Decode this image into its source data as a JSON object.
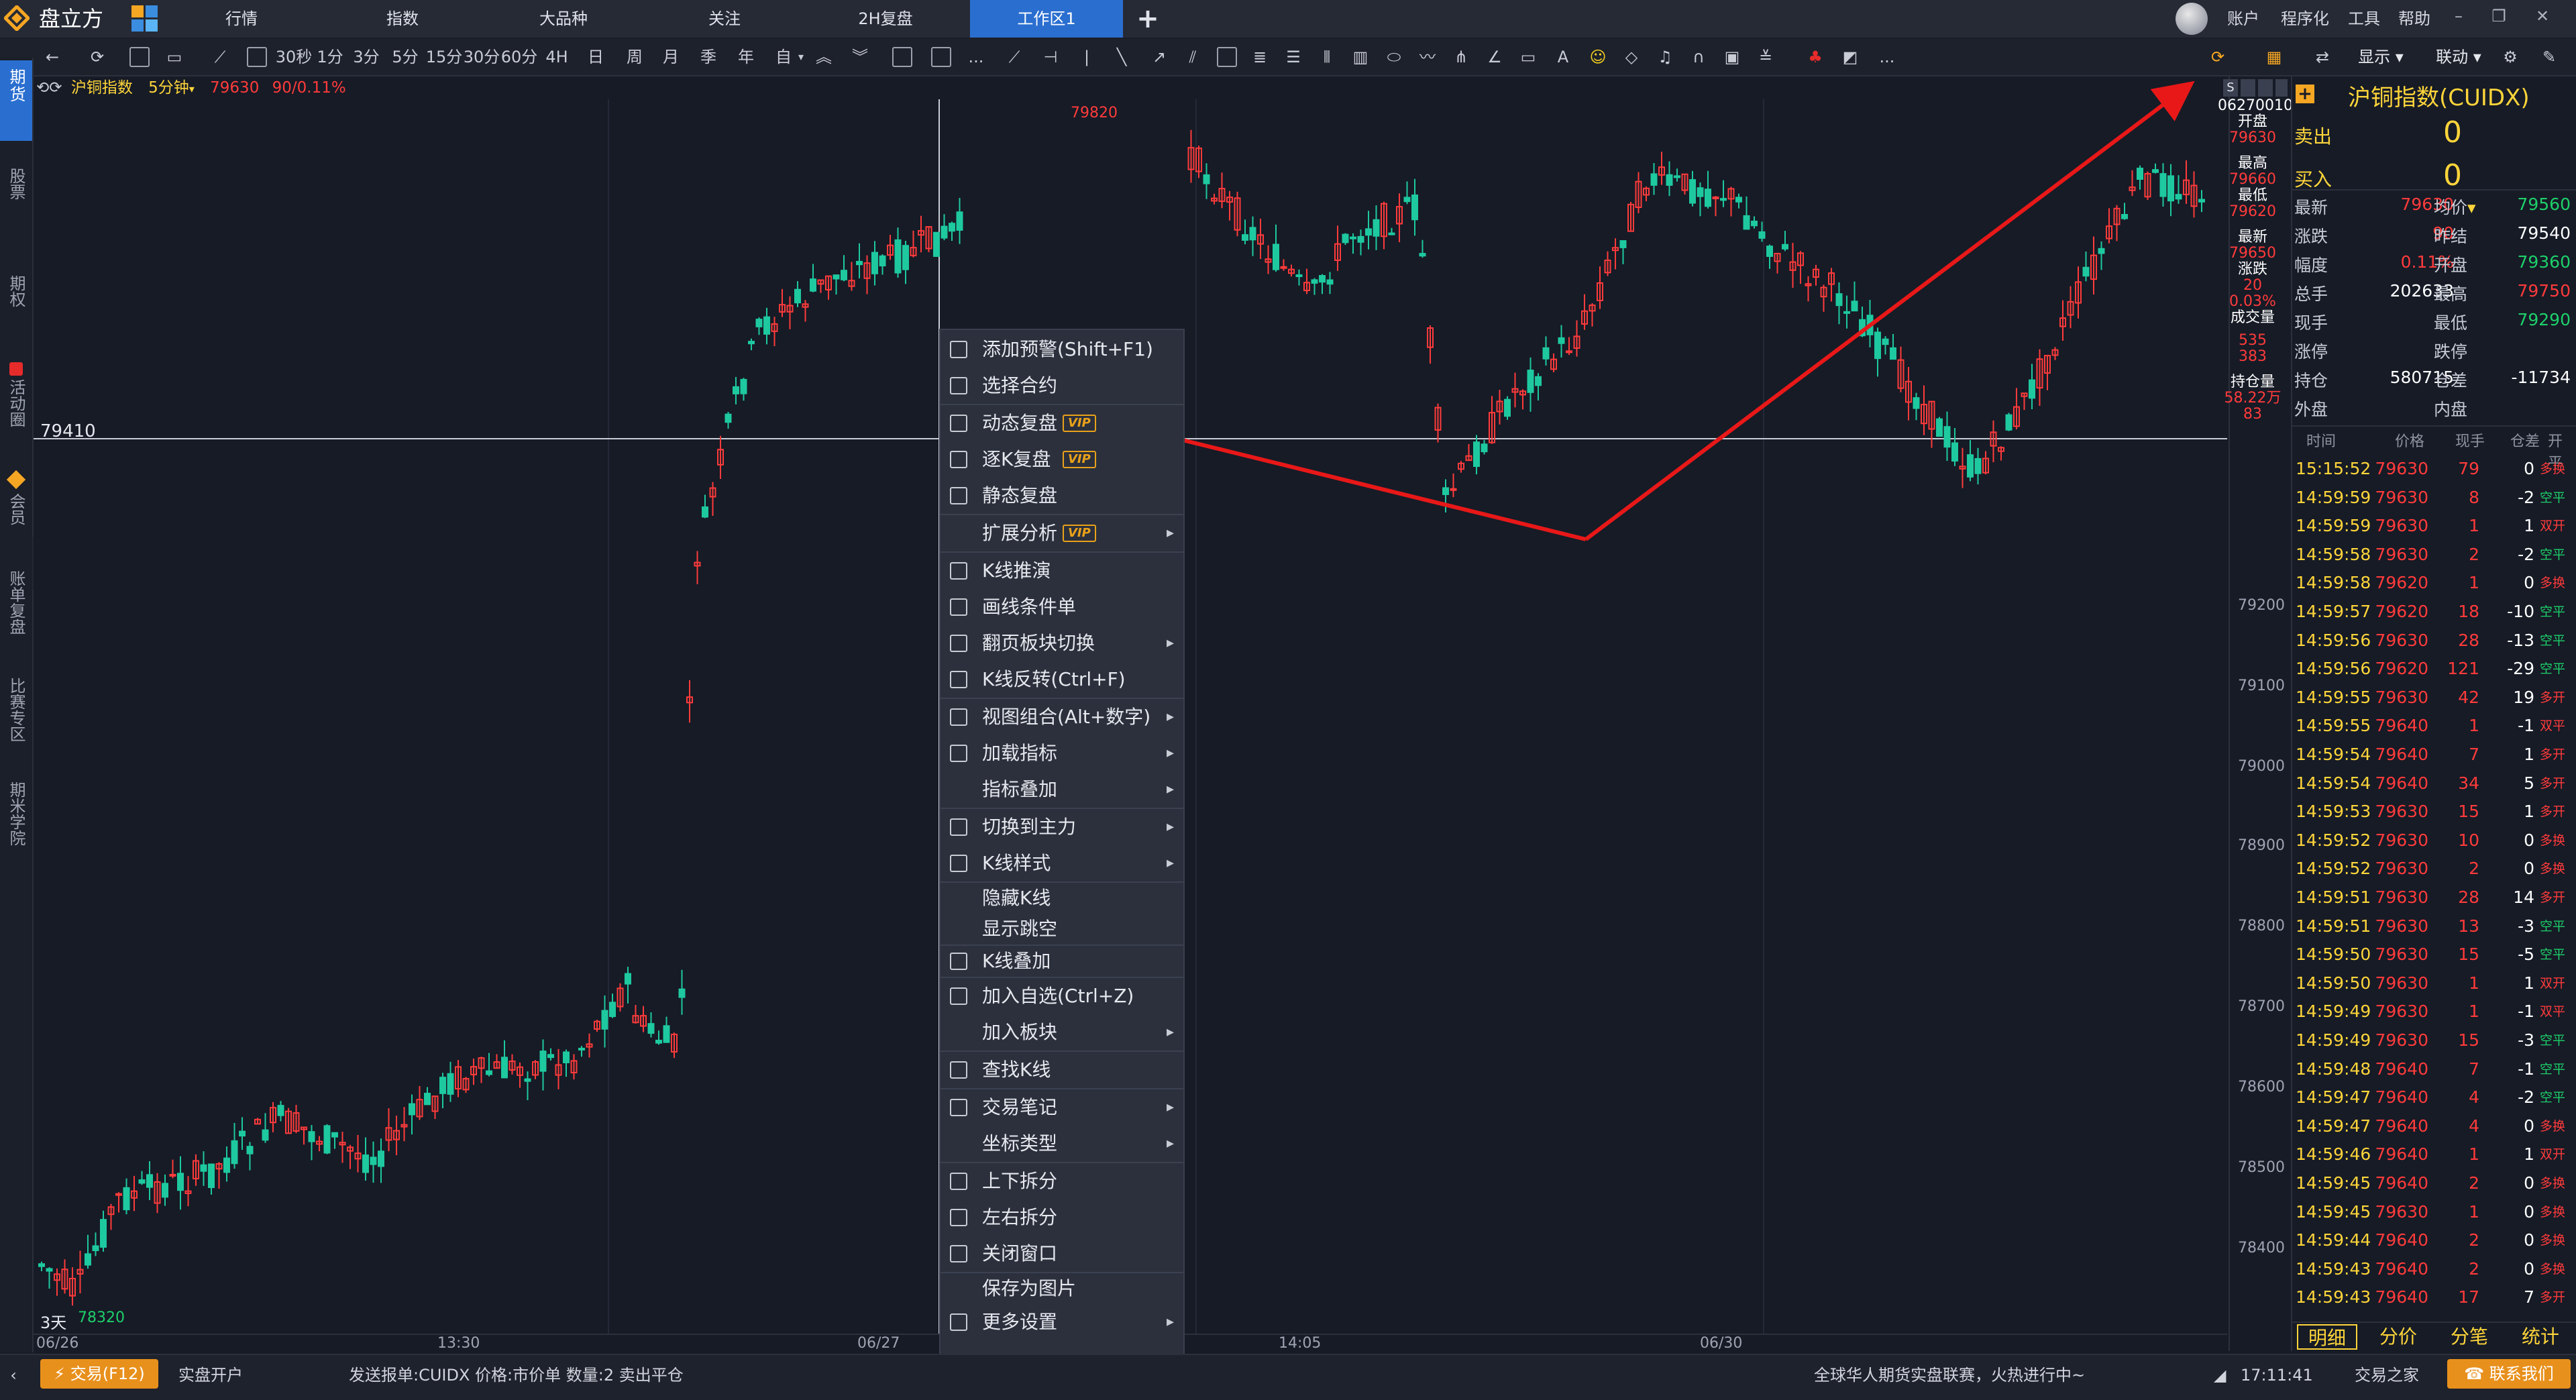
{
  "app": {
    "title": "盘立方"
  },
  "nav": {
    "tabs": [
      {
        "label": "行情"
      },
      {
        "label": "指数"
      },
      {
        "label": "大品种"
      },
      {
        "label": "关注"
      },
      {
        "label": "2H复盘"
      },
      {
        "label": "工作区1"
      }
    ],
    "add": "+",
    "right_menu": [
      "账户",
      "程序化",
      "工具",
      "帮助"
    ]
  },
  "toolbar": {
    "periods": [
      "30秒",
      "1分",
      "3分",
      "5分",
      "15分",
      "30分",
      "60分",
      "4H",
      "日",
      "周",
      "月",
      "季",
      "年",
      "自"
    ],
    "more": "...",
    "right": {
      "display": "显示",
      "link": "联动"
    }
  },
  "sidebar": [
    "期货",
    "股票",
    "期权",
    "活动圈",
    "会员",
    "账单复盘",
    "比赛专区",
    "期米学院"
  ],
  "chart": {
    "symbol": "沪铜指数",
    "period": "5分钟",
    "last": "79630",
    "change": "90/0.11%",
    "crosshair_price": "79410",
    "high_marker": "79820",
    "low_marker": "78320",
    "range_label": "3天",
    "dates": [
      "06/26",
      "13:30",
      "06/27",
      "14:05",
      "06/30"
    ],
    "price_axis": [
      "79200",
      "79100",
      "79000",
      "78900",
      "78800",
      "78700",
      "78600",
      "78500",
      "78400"
    ],
    "info_box": {
      "date": "06270010",
      "open_lbl": "开盘",
      "open": "79630",
      "high_lbl": "最高",
      "high": "79660",
      "low_lbl": "最低",
      "low": "79620",
      "last_lbl": "最新",
      "last": "79650",
      "chg_lbl": "涨跌",
      "chg": "20",
      "chg_pct": "0.03%",
      "vol_lbl": "成交量",
      "vol": "535",
      "vol2": "383",
      "oi_lbl": "持仓量",
      "oi": "58.22万",
      "oi2": "83"
    }
  },
  "context_menu": {
    "items": [
      {
        "label": "添加预警(Shift+F1)",
        "vip": false,
        "sub": false
      },
      {
        "label": "选择合约",
        "vip": false,
        "sub": false
      },
      {
        "label": "动态复盘",
        "vip": true,
        "sub": false
      },
      {
        "label": "逐K复盘",
        "vip": true,
        "sub": false
      },
      {
        "label": "静态复盘",
        "vip": false,
        "sub": false
      },
      {
        "label": "扩展分析",
        "vip": true,
        "sub": true
      },
      {
        "label": "K线推演",
        "vip": false,
        "sub": false
      },
      {
        "label": "画线条件单",
        "vip": false,
        "sub": false
      },
      {
        "label": "翻页板块切换",
        "vip": false,
        "sub": true
      },
      {
        "label": "K线反转(Ctrl+F)",
        "vip": false,
        "sub": false
      },
      {
        "label": "视图组合(Alt+数字)",
        "vip": false,
        "sub": true
      },
      {
        "label": "加载指标",
        "vip": false,
        "sub": true
      },
      {
        "label": "指标叠加",
        "vip": false,
        "sub": true
      },
      {
        "label": "切换到主力",
        "vip": false,
        "sub": true
      },
      {
        "label": "K线样式",
        "vip": false,
        "sub": true
      },
      {
        "label": "隐藏K线",
        "vip": false,
        "sub": false
      },
      {
        "label": "显示跳空",
        "vip": false,
        "sub": false
      },
      {
        "label": "K线叠加",
        "vip": false,
        "sub": false
      },
      {
        "label": "加入自选(Ctrl+Z)",
        "vip": false,
        "sub": false
      },
      {
        "label": "加入板块",
        "vip": false,
        "sub": true
      },
      {
        "label": "查找K线",
        "vip": false,
        "sub": false
      },
      {
        "label": "交易笔记",
        "vip": false,
        "sub": true
      },
      {
        "label": "坐标类型",
        "vip": false,
        "sub": true
      },
      {
        "label": "上下拆分",
        "vip": false,
        "sub": false
      },
      {
        "label": "左右拆分",
        "vip": false,
        "sub": false
      },
      {
        "label": "关闭窗口",
        "vip": false,
        "sub": false
      },
      {
        "label": "保存为图片",
        "vip": false,
        "sub": false
      },
      {
        "label": "更多设置",
        "vip": false,
        "sub": true
      }
    ],
    "vip_tag": "VIP"
  },
  "quote": {
    "title": "沪铜指数(CUIDX)",
    "sell_lbl": "卖出",
    "sell": "0",
    "buy_lbl": "买入",
    "buy": "0",
    "rows": [
      {
        "l1": "最新",
        "v1": "79630",
        "l2": "均价",
        "v2": "79560"
      },
      {
        "l1": "涨跌",
        "v1": "90",
        "l2": "昨结",
        "v2": "79540"
      },
      {
        "l1": "幅度",
        "v1": "0.11%",
        "l2": "开盘",
        "v2": "79360"
      },
      {
        "l1": "总手",
        "v1": "202633",
        "l2": "最高",
        "v2": "79750"
      },
      {
        "l1": "现手",
        "v1": "",
        "l2": "最低",
        "v2": "79290"
      },
      {
        "l1": "涨停",
        "v1": "",
        "l2": "跌停",
        "v2": ""
      },
      {
        "l1": "持仓",
        "v1": "580715",
        "l2": "仓差",
        "v2": "-11734"
      },
      {
        "l1": "外盘",
        "v1": "",
        "l2": "内盘",
        "v2": ""
      }
    ],
    "tick_headers": [
      "时间",
      "价格",
      "现手",
      "仓差",
      "开平"
    ],
    "ticks": [
      {
        "t": "15:15:52",
        "p": "79630",
        "v": "79",
        "d": "0",
        "k": "多换"
      },
      {
        "t": "14:59:59",
        "p": "79630",
        "v": "8",
        "d": "-2",
        "k": "空平"
      },
      {
        "t": "14:59:59",
        "p": "79630",
        "v": "1",
        "d": "1",
        "k": "双开"
      },
      {
        "t": "14:59:58",
        "p": "79630",
        "v": "2",
        "d": "-2",
        "k": "空平"
      },
      {
        "t": "14:59:58",
        "p": "79620",
        "v": "1",
        "d": "0",
        "k": "多换"
      },
      {
        "t": "14:59:57",
        "p": "79620",
        "v": "18",
        "d": "-10",
        "k": "空平"
      },
      {
        "t": "14:59:56",
        "p": "79630",
        "v": "28",
        "d": "-13",
        "k": "空平"
      },
      {
        "t": "14:59:56",
        "p": "79620",
        "v": "121",
        "d": "-29",
        "k": "空平"
      },
      {
        "t": "14:59:55",
        "p": "79630",
        "v": "42",
        "d": "19",
        "k": "多开"
      },
      {
        "t": "14:59:55",
        "p": "79640",
        "v": "1",
        "d": "-1",
        "k": "双平"
      },
      {
        "t": "14:59:54",
        "p": "79640",
        "v": "7",
        "d": "1",
        "k": "多开"
      },
      {
        "t": "14:59:54",
        "p": "79640",
        "v": "34",
        "d": "5",
        "k": "多开"
      },
      {
        "t": "14:59:53",
        "p": "79630",
        "v": "15",
        "d": "1",
        "k": "多开"
      },
      {
        "t": "14:59:52",
        "p": "79630",
        "v": "10",
        "d": "0",
        "k": "多换"
      },
      {
        "t": "14:59:52",
        "p": "79630",
        "v": "2",
        "d": "0",
        "k": "多换"
      },
      {
        "t": "14:59:51",
        "p": "79630",
        "v": "28",
        "d": "14",
        "k": "多开"
      },
      {
        "t": "14:59:51",
        "p": "79630",
        "v": "13",
        "d": "-3",
        "k": "空平"
      },
      {
        "t": "14:59:50",
        "p": "79630",
        "v": "15",
        "d": "-5",
        "k": "空平"
      },
      {
        "t": "14:59:50",
        "p": "79630",
        "v": "1",
        "d": "1",
        "k": "双开"
      },
      {
        "t": "14:59:49",
        "p": "79630",
        "v": "1",
        "d": "-1",
        "k": "双平"
      },
      {
        "t": "14:59:49",
        "p": "79630",
        "v": "15",
        "d": "-3",
        "k": "空平"
      },
      {
        "t": "14:59:48",
        "p": "79640",
        "v": "7",
        "d": "-1",
        "k": "空平"
      },
      {
        "t": "14:59:47",
        "p": "79640",
        "v": "4",
        "d": "-2",
        "k": "空平"
      },
      {
        "t": "14:59:47",
        "p": "79640",
        "v": "4",
        "d": "0",
        "k": "多换"
      },
      {
        "t": "14:59:46",
        "p": "79640",
        "v": "1",
        "d": "1",
        "k": "双开"
      },
      {
        "t": "14:59:45",
        "p": "79640",
        "v": "2",
        "d": "0",
        "k": "多换"
      },
      {
        "t": "14:59:45",
        "p": "79630",
        "v": "1",
        "d": "0",
        "k": "多换"
      },
      {
        "t": "14:59:44",
        "p": "79640",
        "v": "2",
        "d": "0",
        "k": "多换"
      },
      {
        "t": "14:59:43",
        "p": "79640",
        "v": "2",
        "d": "0",
        "k": "多换"
      },
      {
        "t": "14:59:43",
        "p": "79640",
        "v": "17",
        "d": "7",
        "k": "多开"
      }
    ],
    "bottom_tabs": [
      "明细",
      "分价",
      "分笔",
      "统计"
    ]
  },
  "bottom": {
    "trade_btn": "交易(F12)",
    "open_account": "实盘开户",
    "message": "发送报单:CUIDX 价格:市价单  数量:2 卖出平仓",
    "ticker": "全球华人期货实盘联赛，火热进行中~",
    "time": "17:11:41",
    "home": "交易之家",
    "contact": "联系我们"
  }
}
